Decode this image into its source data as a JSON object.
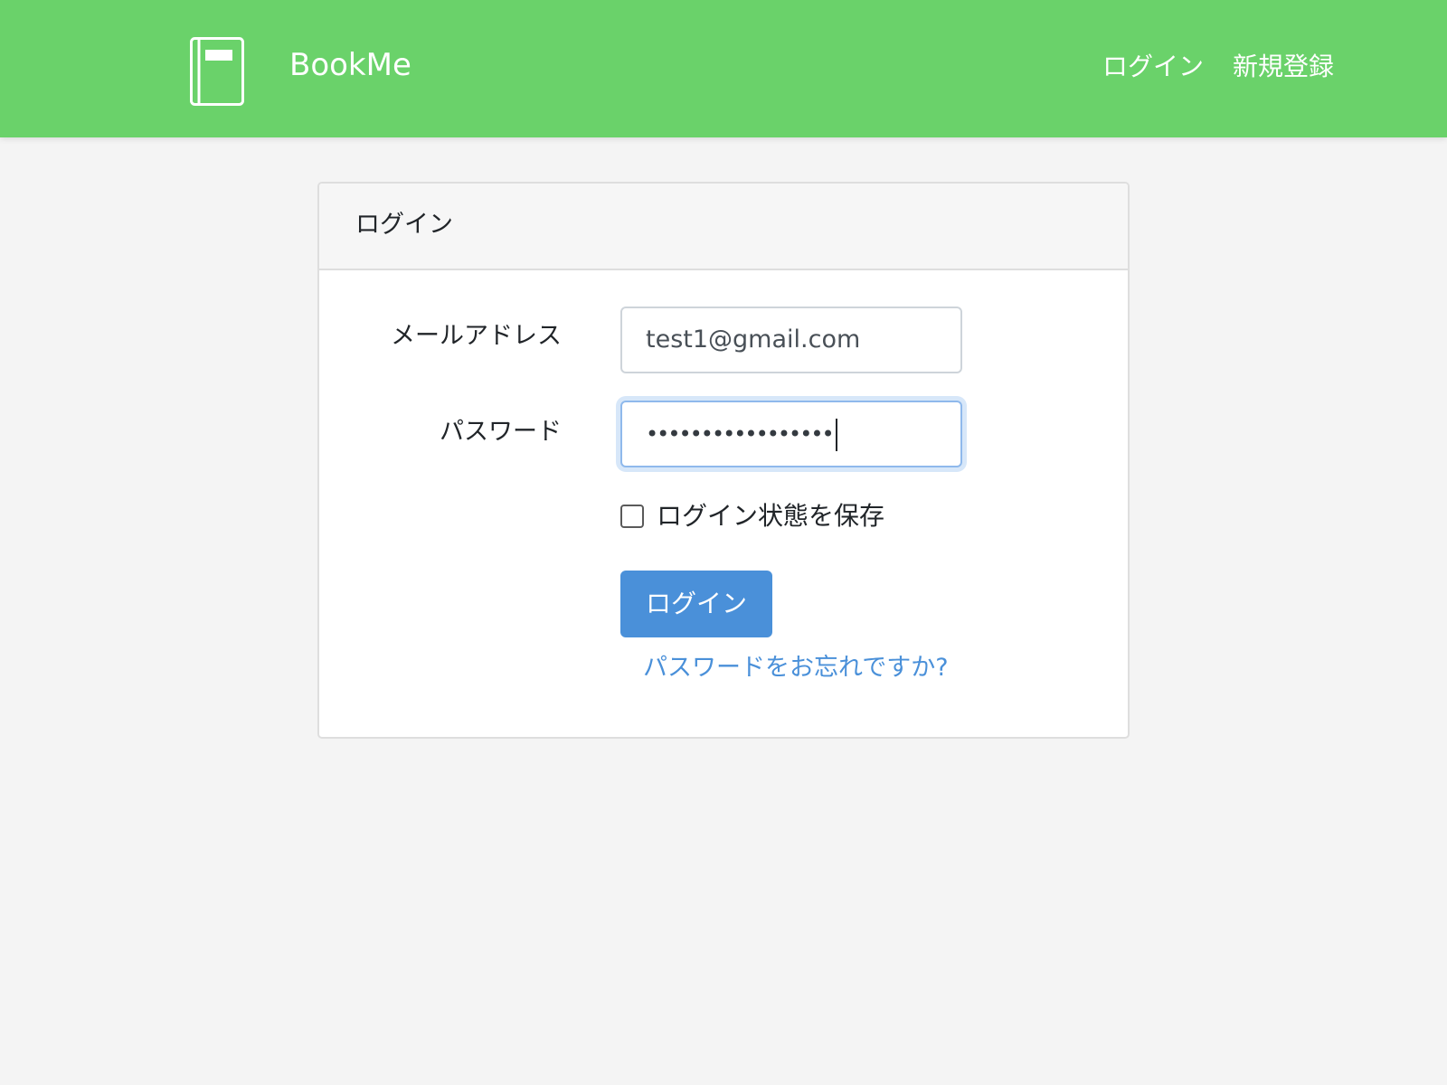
{
  "navbar": {
    "brand": "BookMe",
    "logo_icon": "book-icon",
    "links": [
      "ログイン",
      "新規登録"
    ],
    "background": "#6ad26a"
  },
  "login_card": {
    "title": "ログイン",
    "email_label": "メールアドレス",
    "email_value": "test1@gmail.com",
    "password_label": "パスワード",
    "password_value": "•••••••••••••••••",
    "remember_label": "ログイン状態を保存",
    "remember_checked": false,
    "submit_label": "ログイン",
    "forgot_label": "パスワードをお忘れですか?"
  },
  "colors": {
    "accent": "#4a90d9",
    "page_background": "#f4f4f4"
  }
}
